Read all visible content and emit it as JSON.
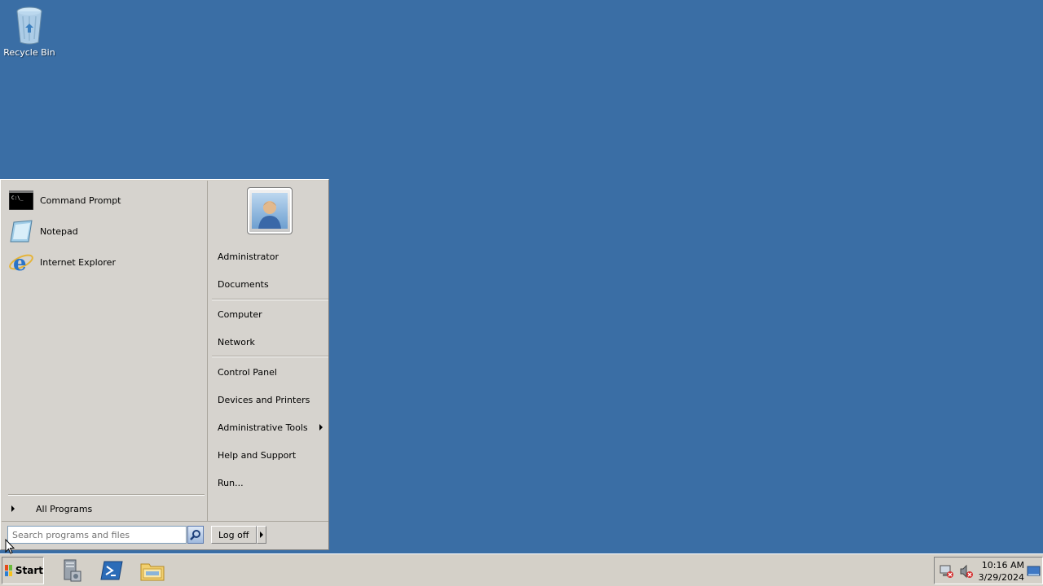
{
  "desktop": {
    "recycle_bin": {
      "label": "Recycle Bin",
      "icon": "recycle-bin-icon"
    }
  },
  "start_menu": {
    "pinned": [
      {
        "label": "Command Prompt",
        "icon": "command-prompt-icon"
      },
      {
        "label": "Notepad",
        "icon": "notepad-icon"
      },
      {
        "label": "Internet Explorer",
        "icon": "internet-explorer-icon"
      }
    ],
    "all_programs_label": "All Programs",
    "right": {
      "user": "Administrator",
      "documents": "Documents",
      "computer": "Computer",
      "network": "Network",
      "control_panel": "Control Panel",
      "devices_printers": "Devices and Printers",
      "admin_tools": "Administrative Tools",
      "help": "Help and Support",
      "run": "Run..."
    },
    "search": {
      "value": "",
      "placeholder": "Search programs and files"
    },
    "logoff_label": "Log off"
  },
  "taskbar": {
    "start_label": "Start",
    "apps": [
      {
        "icon": "server-manager-icon"
      },
      {
        "icon": "powershell-icon"
      },
      {
        "icon": "file-explorer-icon"
      }
    ],
    "clock": {
      "time": "10:16 AM",
      "date": "3/29/2024"
    },
    "tray_icons": [
      "network-error-icon",
      "volume-muted-icon",
      "show-desktop-icon"
    ]
  },
  "colors": {
    "desktop_bg": "#3a6ea5",
    "menu_bg": "#d6d3ce"
  }
}
